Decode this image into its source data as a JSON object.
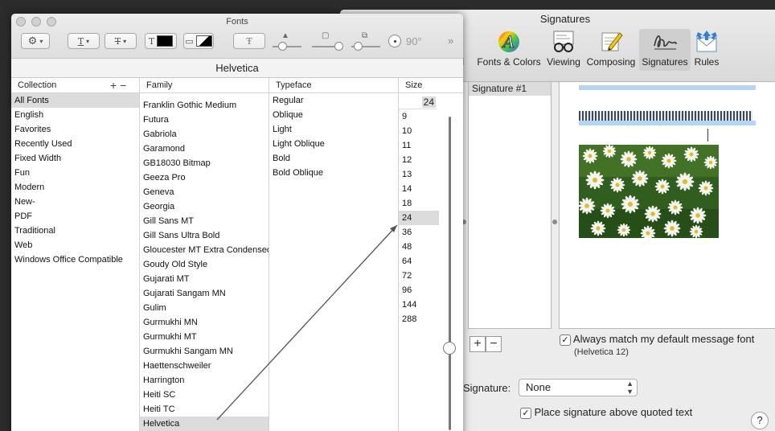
{
  "signatures_window": {
    "title": "Signatures",
    "toolbar": [
      {
        "label": "ail",
        "icon": "general-icon"
      },
      {
        "label": "Fonts & Colors",
        "icon": "fonts-colors-icon"
      },
      {
        "label": "Viewing",
        "icon": "viewing-icon"
      },
      {
        "label": "Composing",
        "icon": "composing-icon"
      },
      {
        "label": "Signatures",
        "icon": "signatures-icon",
        "active": true
      },
      {
        "label": "Rules",
        "icon": "rules-icon"
      }
    ],
    "signature_list": [
      "Signature #1"
    ],
    "add_label": "+",
    "remove_label": "−",
    "always_match_label": "Always match my default message font",
    "always_match_checked": true,
    "default_font_note": "(Helvetica 12)",
    "signature_label": "Signature:",
    "signature_select_value": "None",
    "place_above_label": "Place signature above quoted text",
    "place_above_checked": true,
    "help_label": "?"
  },
  "fonts_panel": {
    "title": "Fonts",
    "current_font": "Helvetica",
    "rotation_value": "90°",
    "collection_header": "Collection",
    "family_header": "Family",
    "typeface_header": "Typeface",
    "size_header": "Size",
    "collection_add": "+",
    "collection_remove": "−",
    "collections": [
      "All Fonts",
      "English",
      "Favorites",
      "Recently Used",
      "Fixed Width",
      "Fun",
      "Modern",
      "New-",
      "PDF",
      "Traditional",
      "Web",
      "Windows Office Compatible"
    ],
    "selected_collection": "All Fonts",
    "families": [
      "Franklin Gothic Medium",
      "Futura",
      "Gabriola",
      "Garamond",
      "GB18030 Bitmap",
      "Geeza Pro",
      "Geneva",
      "Georgia",
      "Gill Sans MT",
      "Gill Sans Ultra Bold",
      "Gloucester MT Extra Condensed",
      "Goudy Old Style",
      "Gujarati MT",
      "Gujarati Sangam MN",
      "Gulim",
      "Gurmukhi MN",
      "Gurmukhi MT",
      "Gurmukhi Sangam MN",
      "Haettenschweiler",
      "Harrington",
      "Heiti SC",
      "Heiti TC",
      "Helvetica"
    ],
    "selected_family": "Helvetica",
    "typefaces": [
      "Regular",
      "Oblique",
      "Light",
      "Light Oblique",
      "Bold",
      "Bold Oblique"
    ],
    "size_value": "24",
    "sizes": [
      "9",
      "10",
      "11",
      "12",
      "13",
      "14",
      "18",
      "24",
      "36",
      "48",
      "64",
      "72",
      "96",
      "144",
      "288"
    ],
    "selected_size": "24"
  }
}
